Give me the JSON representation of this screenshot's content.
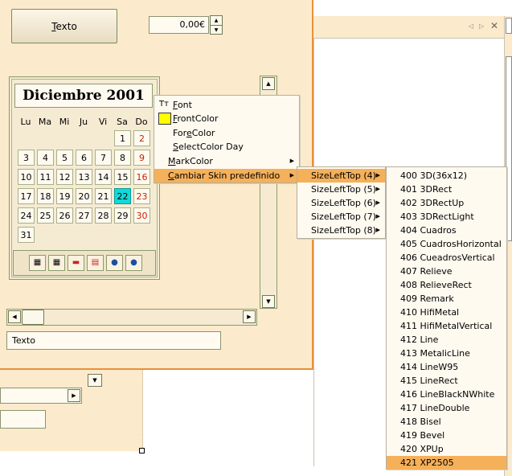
{
  "text_button": {
    "label": "Texto",
    "underline": "T",
    "rest": "exto"
  },
  "currency_field": {
    "value": "0,00€"
  },
  "calendar": {
    "title": "Diciembre 2001",
    "day_headers": [
      "Lu",
      "Ma",
      "Mi",
      "Ju",
      "Vi",
      "Sa",
      "Do"
    ],
    "weeks": [
      [
        "",
        "",
        "",
        "",
        "",
        "1",
        "2"
      ],
      [
        "3",
        "4",
        "5",
        "6",
        "7",
        "8",
        "9"
      ],
      [
        "10",
        "11",
        "12",
        "13",
        "14",
        "15",
        "16"
      ],
      [
        "17",
        "18",
        "19",
        "20",
        "21",
        "22",
        "23"
      ],
      [
        "24",
        "25",
        "26",
        "27",
        "28",
        "29",
        "30"
      ],
      [
        "31",
        "",
        "",
        "",
        "",
        "",
        ""
      ]
    ],
    "today": "22",
    "sunday_color": "#cc2200",
    "today_color": "#12d9d9"
  },
  "text_field": {
    "value": "Texto"
  },
  "context_menu": {
    "items": [
      {
        "pre": "",
        "u": "F",
        "post": "ont",
        "icon": "font-icon"
      },
      {
        "pre": "",
        "u": "F",
        "post": "rontColor",
        "icon": "front-color-icon"
      },
      {
        "pre": "For",
        "u": "e",
        "post": "Color",
        "icon": ""
      },
      {
        "pre": "",
        "u": "S",
        "post": "electColor Day",
        "icon": ""
      },
      {
        "pre": "",
        "u": "M",
        "post": "arkColor",
        "icon": "",
        "submenu": true
      },
      {
        "pre": "",
        "u": "C",
        "post": "ambiar Skin predefinido",
        "icon": "",
        "submenu": true,
        "highlight": true
      }
    ]
  },
  "skin_submenu": {
    "items": [
      "SizeLeftTop (4)",
      "SizeLeftTop (5)",
      "SizeLeftTop (6)",
      "SizeLeftTop (7)",
      "SizeLeftTop (8)"
    ],
    "highlighted": "SizeLeftTop (4)"
  },
  "style_submenu": {
    "items": [
      "400 3D(36x12)",
      "401 3DRect",
      "402 3DRectUp",
      "403 3DRectLight",
      "404 Cuadros",
      "405 CuadrosHorizontal",
      "406 CueadrosVertical",
      "407 Relieve",
      "408 RelieveRect",
      "409 Remark",
      "410 HifiMetal",
      "411 HifiMetalVertical",
      "412 Line",
      "413 MetalicLine",
      "414 LineW95",
      "415 LineRect",
      "416 LineBlackNWhite",
      "417 LineDouble",
      "418 Bisel",
      "419 Bevel",
      "420 XPUp",
      "421 XP2505"
    ],
    "highlighted": "421 XP2505"
  },
  "accent_color": "#f5b05a",
  "panel_border_color": "#e8913a"
}
